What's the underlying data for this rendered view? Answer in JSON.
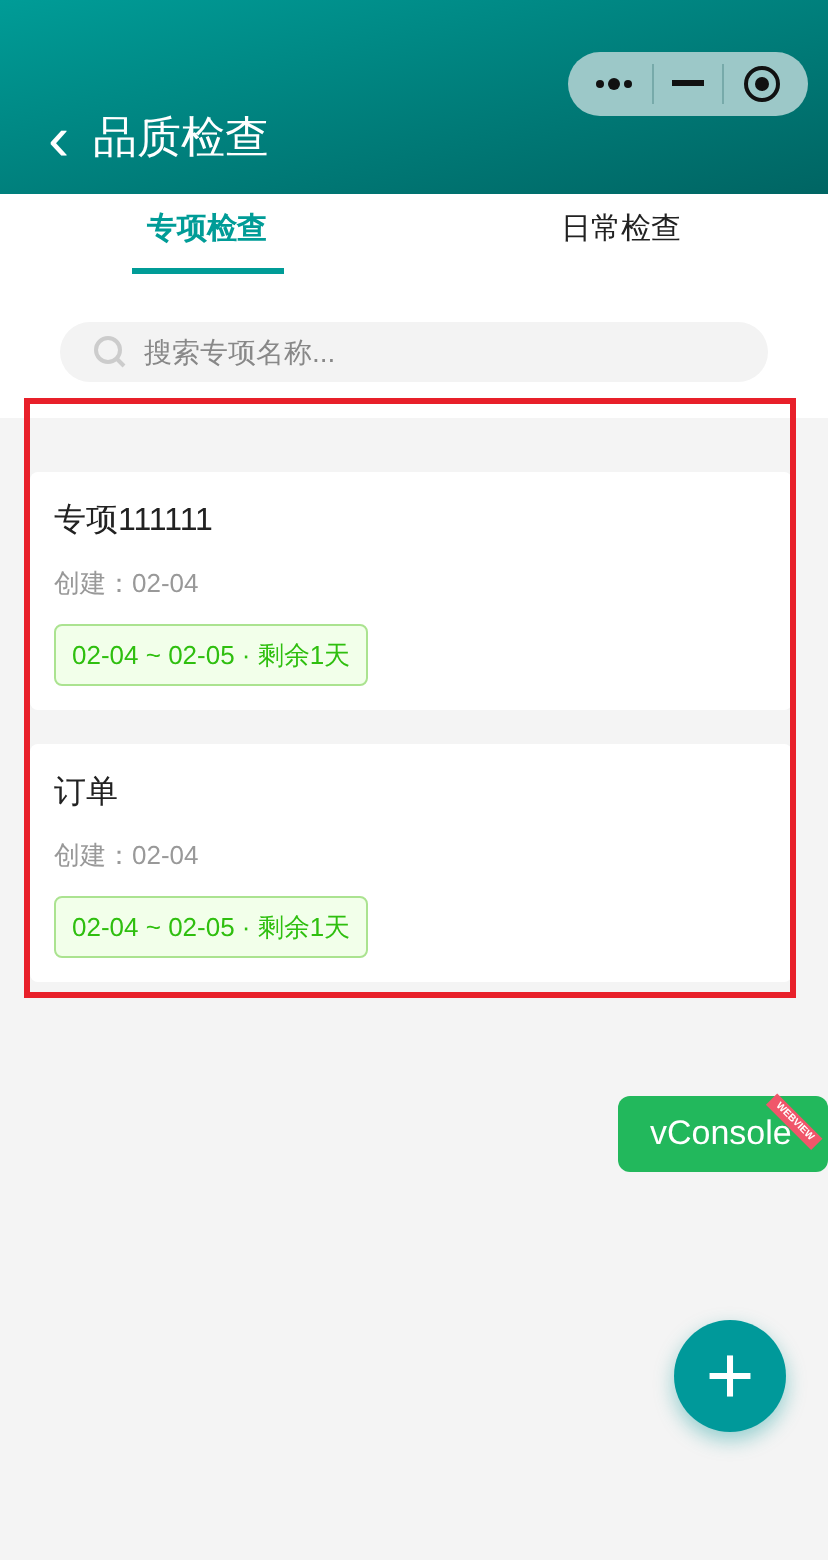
{
  "header": {
    "back": "‹",
    "title": "品质检查"
  },
  "tabs": [
    {
      "label": "专项检查",
      "selected": true
    },
    {
      "label": "日常检查",
      "selected": false
    }
  ],
  "search": {
    "placeholder": "搜索专项名称..."
  },
  "items": [
    {
      "name": "专项111111",
      "created": "创建：02-04",
      "period": "02-04 ~ 02-05 · 剩余1天"
    },
    {
      "name": "订单",
      "created": "创建：02-04",
      "period": "02-04 ~ 02-05 · 剩余1天"
    }
  ],
  "vconsole": {
    "label": "vConsole",
    "ribbon": "WEBVIEW"
  },
  "fab": {
    "label": "+"
  }
}
